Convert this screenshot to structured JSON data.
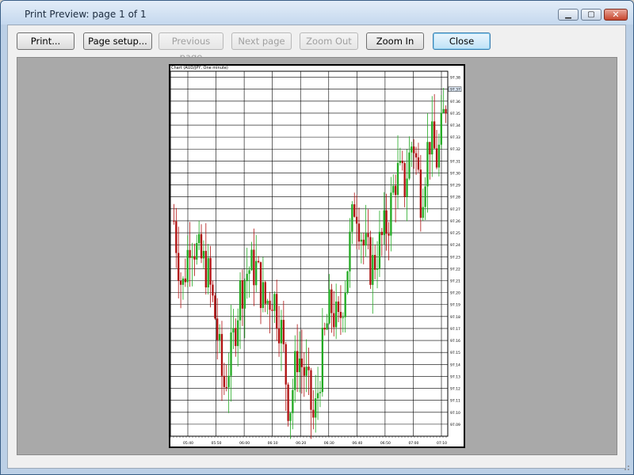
{
  "window": {
    "title": "Print Preview: page 1 of 1",
    "minimize_glyph": "▁",
    "maximize_glyph": "▢",
    "close_glyph": "✕"
  },
  "toolbar": {
    "print_label": "Print...",
    "page_setup_label": "Page setup...",
    "previous_page_label": "Previous page",
    "next_page_label": "Next page",
    "zoom_out_label": "Zoom Out",
    "zoom_in_label": "Zoom In",
    "close_label": "Close"
  },
  "chart_data": {
    "type": "candlestick",
    "title": "Chart (AUD/JPY, One minute)",
    "x_tick_labels": [
      "05:40",
      "05:50",
      "06:00",
      "06:10",
      "06:20",
      "06:30",
      "06:40",
      "06:50",
      "07:00",
      "07:10"
    ],
    "y_tick_labels": [
      "97.38",
      "97.37",
      "97.36",
      "97.35",
      "97.34",
      "97.33",
      "97.32",
      "97.31",
      "97.30",
      "97.29",
      "97.28",
      "97.27",
      "97.26",
      "97.25",
      "97.24",
      "97.23",
      "97.22",
      "97.21",
      "97.20",
      "97.19",
      "97.18",
      "97.17",
      "97.16",
      "97.15",
      "97.14",
      "97.13",
      "97.12",
      "97.11",
      "97.10",
      "97.09"
    ],
    "ylim": [
      97.08,
      97.385
    ],
    "last_price": "97.37",
    "grid": true,
    "up_color": "#22aa22",
    "down_color": "#b01010",
    "close_path": [
      97.26,
      97.2,
      97.25,
      97.23,
      97.22,
      97.18,
      97.12,
      97.15,
      97.2,
      97.22,
      97.22,
      97.19,
      97.2,
      97.17,
      97.1,
      97.15,
      97.13,
      97.09,
      97.15,
      97.19,
      97.17,
      97.22,
      97.28,
      97.24,
      97.22,
      97.24,
      97.26,
      97.3,
      97.29,
      97.33,
      97.28,
      97.33,
      97.31,
      97.36
    ]
  }
}
